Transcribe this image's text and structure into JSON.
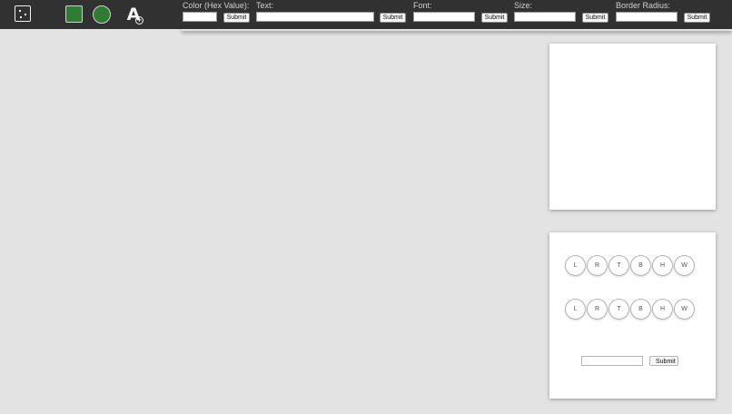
{
  "toolbar": {
    "tools": [
      {
        "name": "dotted-box-icon"
      },
      {
        "name": "square-shape-icon",
        "color": "#2e7d32"
      },
      {
        "name": "circle-shape-icon",
        "color": "#2e7d32"
      },
      {
        "name": "add-text-icon",
        "glyph": "A",
        "badge": "+"
      }
    ],
    "fields": {
      "color": {
        "label": "Color (Hex Value):",
        "value": "",
        "submit": "Submit"
      },
      "text": {
        "label": "Text:",
        "value": "",
        "submit": "Submit"
      },
      "font": {
        "label": "Font:",
        "value": "",
        "submit": "Submit"
      },
      "size": {
        "label": "Size:",
        "value": "",
        "submit": "Submit"
      },
      "border_radius": {
        "label": "Border Radius:",
        "value": "",
        "submit": "Submit"
      }
    }
  },
  "controls": {
    "row1": [
      "L",
      "R",
      "T",
      "B",
      "H",
      "W"
    ],
    "row2": [
      "L",
      "R",
      "T",
      "B",
      "H",
      "W"
    ],
    "input_value": "",
    "submit": "Submit"
  },
  "colors": {
    "toolbar_bg": "#313131",
    "canvas_bg": "#e3e3e3",
    "shape_fill": "#2e7d32"
  }
}
